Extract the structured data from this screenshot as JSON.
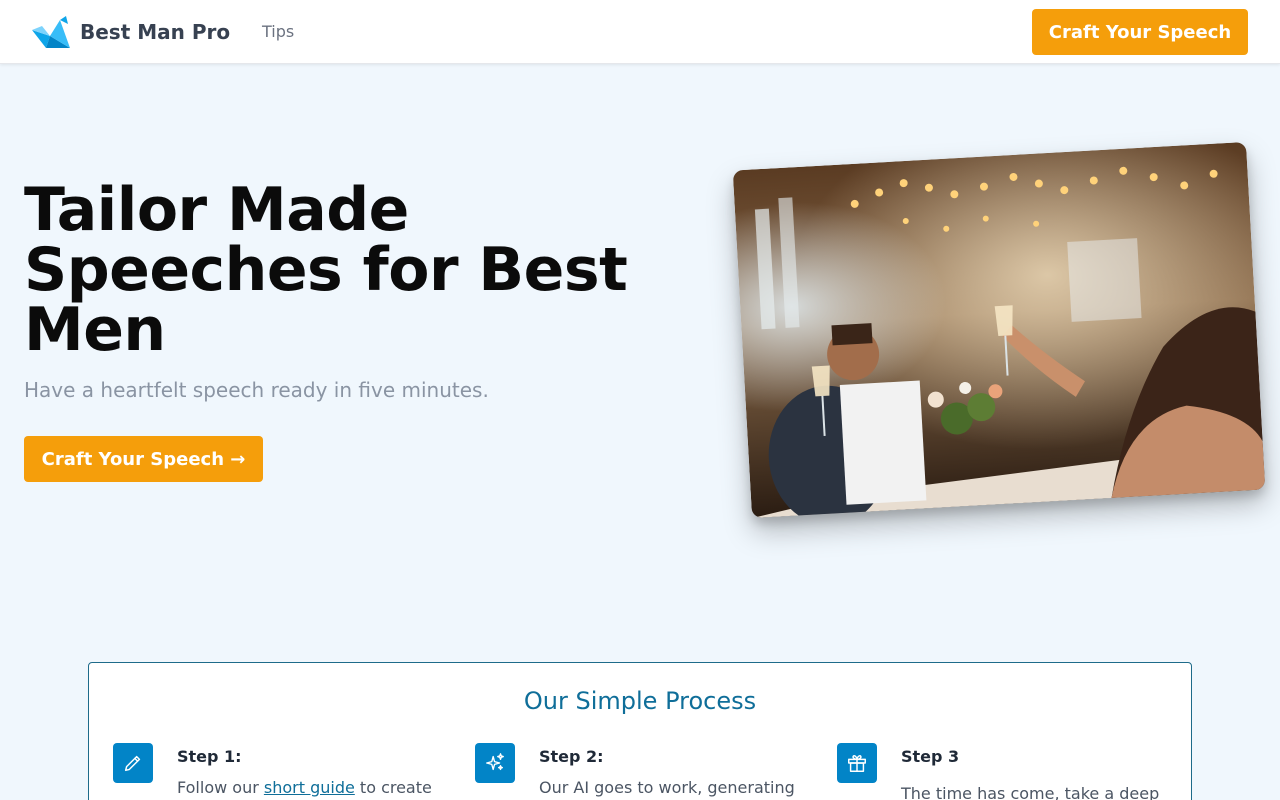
{
  "header": {
    "brand": "Best Man Pro",
    "nav": [
      "Tips"
    ],
    "cta_label": "Craft Your Speech"
  },
  "hero": {
    "title": "Tailor Made Speeches for Best Men",
    "subtitle": "Have a heartfelt speech ready in five minutes.",
    "cta_label": "Craft Your Speech →",
    "image_description": "wedding-reception-toast-photo"
  },
  "process": {
    "title": "Our Simple Process",
    "steps": [
      {
        "icon": "pencil-icon",
        "title": "Step 1:",
        "text_before": "Follow our ",
        "link": "short guide",
        "text_after": " to create"
      },
      {
        "icon": "sparkles-icon",
        "title": "Step 2:",
        "text": "Our AI goes to work, generating"
      },
      {
        "icon": "gift-icon",
        "title": "Step 3",
        "text": "The time has come, take a deep"
      }
    ]
  },
  "colors": {
    "accent": "#f59e0b",
    "primary": "#0284c7",
    "background": "#f0f7fd"
  }
}
